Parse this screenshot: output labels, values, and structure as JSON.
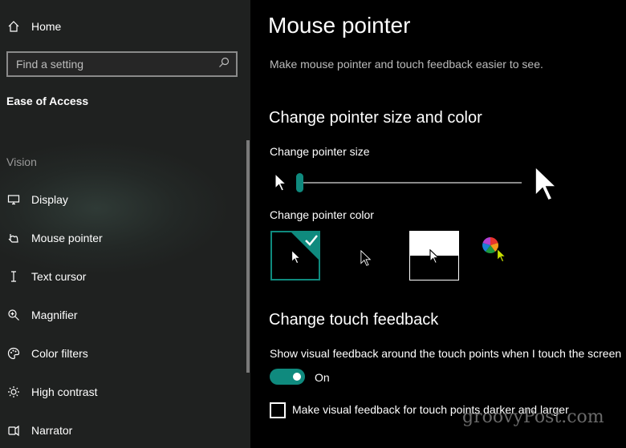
{
  "sidebar": {
    "home_label": "Home",
    "search_placeholder": "Find a setting",
    "section_title": "Ease of Access",
    "group_header": "Vision",
    "items": [
      {
        "label": "Display",
        "icon": "monitor-icon"
      },
      {
        "label": "Mouse pointer",
        "icon": "mouse-pointer-icon"
      },
      {
        "label": "Text cursor",
        "icon": "text-cursor-icon"
      },
      {
        "label": "Magnifier",
        "icon": "magnifier-icon"
      },
      {
        "label": "Color filters",
        "icon": "color-filters-icon"
      },
      {
        "label": "High contrast",
        "icon": "high-contrast-icon"
      },
      {
        "label": "Narrator",
        "icon": "narrator-icon"
      }
    ]
  },
  "main": {
    "title": "Mouse pointer",
    "description": "Make mouse pointer and touch feedback easier to see.",
    "pointer_section": {
      "heading": "Change pointer size and color",
      "size_label": "Change pointer size",
      "size_value": 1,
      "color_label": "Change pointer color",
      "color_options": [
        "white",
        "black",
        "inverted",
        "custom"
      ],
      "selected_color_option": "white"
    },
    "touch_section": {
      "heading": "Change touch feedback",
      "show_feedback_label": "Show visual feedback around the touch points when I touch the screen",
      "toggle_state": "On",
      "darker_checkbox_label": "Make visual feedback for touch points darker and larger",
      "darker_checked": false
    }
  },
  "watermark": "groovyPost.com",
  "colors": {
    "accent": "#0f8a7e",
    "sidebar_bg": "#1f2120",
    "main_bg": "#000000"
  }
}
